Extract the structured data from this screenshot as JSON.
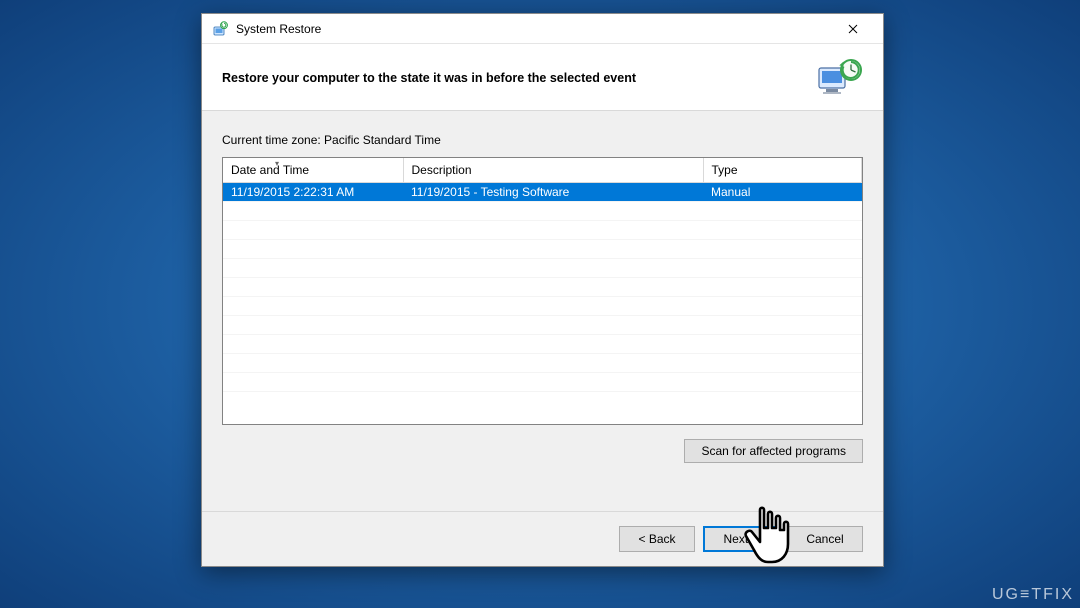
{
  "window": {
    "title": "System Restore",
    "heading": "Restore your computer to the state it was in before the selected event",
    "timezone_label": "Current time zone: Pacific Standard Time"
  },
  "table": {
    "columns": [
      "Date and Time",
      "Description",
      "Type"
    ],
    "rows": [
      {
        "datetime": "11/19/2015 2:22:31 AM",
        "description": "11/19/2015 - Testing Software",
        "type": "Manual"
      }
    ]
  },
  "buttons": {
    "scan": "Scan for affected programs",
    "back": "< Back",
    "next": "Next >",
    "cancel": "Cancel"
  },
  "watermark": "UG≡TFIX"
}
